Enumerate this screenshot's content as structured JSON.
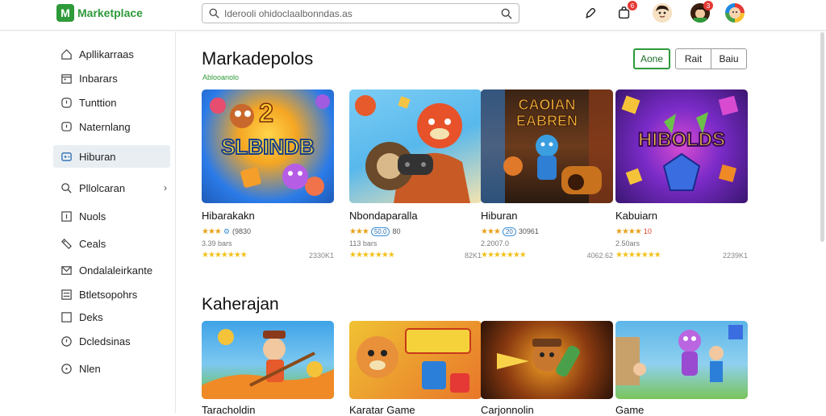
{
  "app": {
    "name": "Marketplace"
  },
  "search": {
    "placeholder": "Iderooli ohidoclaalbonndas.as"
  },
  "topbar": {
    "cart_badge": "6",
    "profile_badge": "3"
  },
  "sidebar": {
    "items": [
      {
        "label": "Apllikarraas",
        "icon": "home-icon"
      },
      {
        "label": "Inbarars",
        "icon": "calendar-icon"
      },
      {
        "label": "Tunttion",
        "icon": "clock-icon"
      },
      {
        "label": "Naternlang",
        "icon": "chat-icon"
      },
      {
        "label": "Hiburan",
        "icon": "gamepad-icon",
        "active": true
      },
      {
        "label": "Pllolcaran",
        "icon": "search-icon",
        "chevron": "›"
      },
      {
        "label": "Nuols",
        "icon": "image-icon"
      },
      {
        "label": "Ceals",
        "icon": "tag-icon"
      },
      {
        "label": "Ondalaleirkante",
        "icon": "mail-icon"
      },
      {
        "label": "Btletsopohrs",
        "icon": "list-icon"
      },
      {
        "label": "Deks",
        "icon": "square-icon"
      },
      {
        "label": "Dcledsinas",
        "icon": "shield-icon"
      },
      {
        "label": "Nlen",
        "icon": "info-icon"
      }
    ]
  },
  "main": {
    "title": "Markadepolos",
    "subtitle": "Ablooanolo",
    "filters": [
      {
        "label": "Aone",
        "active": true
      },
      {
        "label": "Rait"
      },
      {
        "label": "Baiu"
      }
    ],
    "cards": [
      {
        "art": "SLBINDB",
        "art_top": "2",
        "title": "Hibarakakn",
        "rating_text": "(9830",
        "count": "3.39 bars",
        "bottom_right": "2330K1",
        "colors": [
          "#2b7be8",
          "#f6c445",
          "#e64d6e"
        ]
      },
      {
        "art": "",
        "art_top": "",
        "title": "Nbondaparalla",
        "pill": "50.0",
        "rating_text": "80",
        "count": "113 bars",
        "bottom_right": "82K1",
        "colors": [
          "#58b8ec",
          "#e65a2c",
          "#f4e3b0"
        ]
      },
      {
        "art": "EABREN",
        "art_top": "CAOIAN",
        "title": "Hiburan",
        "pill": "20",
        "rating_text": "30961",
        "count": "2.2007.0",
        "bottom_right": "4062.62",
        "colors": [
          "#5a3a24",
          "#f1a72b",
          "#2f7fd4"
        ]
      },
      {
        "art": "HIBOLDS",
        "art_top": "",
        "title": "Kabuiarn",
        "rating_text": "10",
        "count": "2.50ars",
        "bottom_right": "2239K1",
        "colors": [
          "#4b1b8a",
          "#d84bd1",
          "#f5c33a"
        ]
      }
    ],
    "section_title": "Kaherajan",
    "cards2": [
      {
        "title": "Taracholdin",
        "colors": [
          "#3fa3e8",
          "#f08a26",
          "#6cc04a"
        ]
      },
      {
        "title": "Karatar Game",
        "colors": [
          "#f0c233",
          "#e8752a",
          "#2c7fd8"
        ]
      },
      {
        "title": "Carjonnolin",
        "colors": [
          "#3a2015",
          "#f4a126",
          "#6b3b1c"
        ]
      },
      {
        "title": "Game",
        "colors": [
          "#5db6e8",
          "#b966e0",
          "#7ac45a"
        ]
      }
    ]
  }
}
